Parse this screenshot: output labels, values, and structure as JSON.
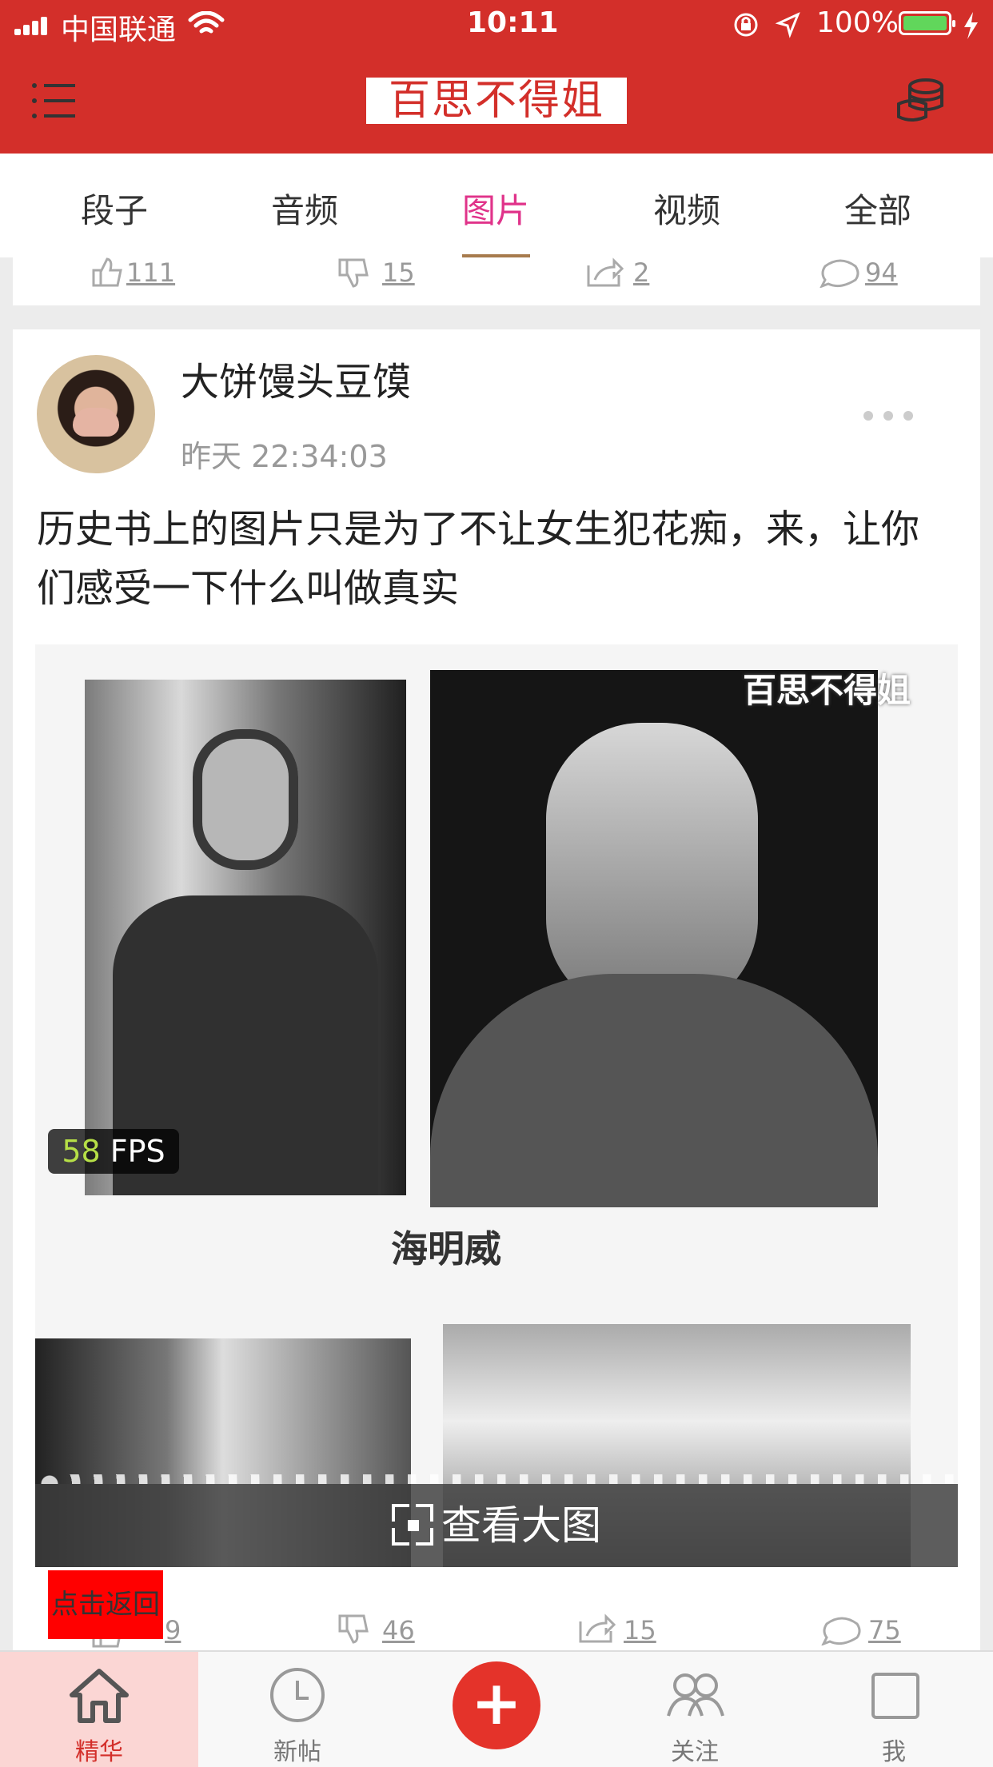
{
  "status_bar": {
    "carrier": "中国联通",
    "time": "10:11",
    "battery": "100%"
  },
  "header": {
    "logo": "百思不得姐",
    "menu_icon": "menu-icon",
    "coins_icon": "coins-icon"
  },
  "tabs": [
    {
      "label": "段子"
    },
    {
      "label": "音频"
    },
    {
      "label": "图片"
    },
    {
      "label": "视频"
    },
    {
      "label": "全部"
    }
  ],
  "active_tab": "图片",
  "prev_actions": {
    "up": "111",
    "down": "15",
    "share": "2",
    "comment": "94"
  },
  "post": {
    "author": "大饼馒头豆馍",
    "time": "昨天 22:34:03",
    "text": "历史书上的图片只是为了不让女生犯花痴，来，让你们感受一下什么叫做真实",
    "image_watermark": "百思不得姐",
    "image_caption": "海明威",
    "fps_value": "58",
    "fps_unit": "FPS",
    "view_large": "查看大图",
    "actions": {
      "up": "9",
      "down": "46",
      "share": "15",
      "comment": "75"
    }
  },
  "back_button": "点击返回",
  "bottom_nav": [
    {
      "label": "精华"
    },
    {
      "label": "新帖"
    },
    {
      "label": "发布"
    },
    {
      "label": "关注"
    },
    {
      "label": "我"
    }
  ],
  "colors": {
    "brand_red": "#d32f2a",
    "active_tab": "#e0338a",
    "active_nav_bg": "#fbd6d4"
  }
}
